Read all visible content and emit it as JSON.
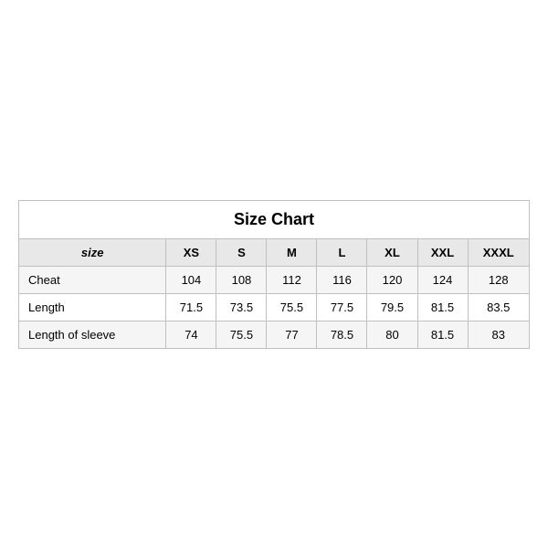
{
  "table": {
    "title": "Size Chart",
    "headers": [
      "size",
      "XS",
      "S",
      "M",
      "L",
      "XL",
      "XXL",
      "XXXL"
    ],
    "rows": [
      {
        "label": "Cheat",
        "values": [
          "104",
          "108",
          "112",
          "116",
          "120",
          "124",
          "128"
        ]
      },
      {
        "label": "Length",
        "values": [
          "71.5",
          "73.5",
          "75.5",
          "77.5",
          "79.5",
          "81.5",
          "83.5"
        ]
      },
      {
        "label": "Length of sleeve",
        "values": [
          "74",
          "75.5",
          "77",
          "78.5",
          "80",
          "81.5",
          "83"
        ]
      }
    ]
  }
}
